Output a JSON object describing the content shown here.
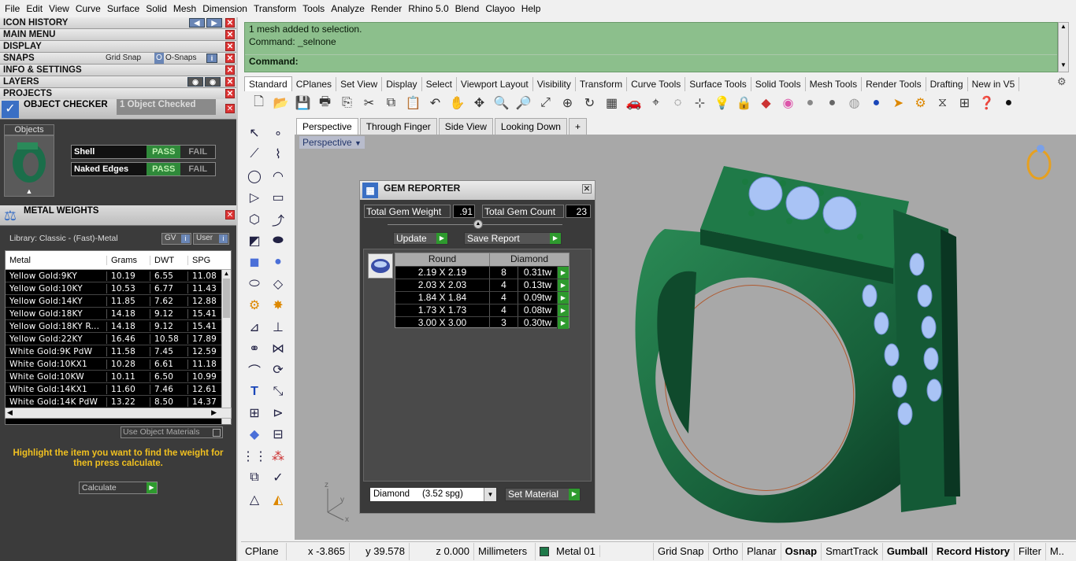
{
  "menu": [
    "File",
    "Edit",
    "View",
    "Curve",
    "Surface",
    "Solid",
    "Mesh",
    "Dimension",
    "Transform",
    "Tools",
    "Analyze",
    "Render",
    "Rhino 5.0",
    "Blend",
    "Clayoo",
    "Help"
  ],
  "left": {
    "sections": {
      "icon_history": "ICON HISTORY",
      "main_menu": "MAIN MENU",
      "display": "DISPLAY",
      "snaps": "SNAPS",
      "snaps_grid": "Grid Snap",
      "snaps_osnap": "O-Snaps",
      "info": "INFO & SETTINGS",
      "layers": "LAYERS",
      "projects": "PROJECTS"
    },
    "object_checker": {
      "title": "OBJECT CHECKER",
      "status": "1 Object Checked",
      "objects_label": "Objects",
      "rows": [
        {
          "label": "Shell",
          "pass": "PASS",
          "fail": "FAIL"
        },
        {
          "label": "Naked Edges",
          "pass": "PASS",
          "fail": "FAIL"
        }
      ]
    },
    "metal_weights": {
      "title": "METAL WEIGHTS",
      "library": "Library: Classic - (Fast)-Metal",
      "gv": "GV",
      "user": "User",
      "headers": [
        "Metal",
        "Grams",
        "DWT",
        "SPG"
      ],
      "rows": [
        [
          "Yellow Gold:9KY",
          "10.19",
          "6.55",
          "11.08"
        ],
        [
          "Yellow Gold:10KY",
          "10.53",
          "6.77",
          "11.43"
        ],
        [
          "Yellow Gold:14KY",
          "11.85",
          "7.62",
          "12.88"
        ],
        [
          "Yellow Gold:18KY",
          "14.18",
          "9.12",
          "15.41"
        ],
        [
          "Yellow Gold:18KY R...",
          "14.18",
          "9.12",
          "15.41"
        ],
        [
          "Yellow Gold:22KY",
          "16.46",
          "10.58",
          "17.89"
        ],
        [
          "White Gold:9K PdW",
          "11.58",
          "7.45",
          "12.59"
        ],
        [
          "White Gold:10KX1",
          "10.28",
          "6.61",
          "11.18"
        ],
        [
          "White Gold:10KW",
          "10.11",
          "6.50",
          "10.99"
        ],
        [
          "White Gold:14KX1",
          "11.60",
          "7.46",
          "12.61"
        ],
        [
          "White Gold:14K PdW",
          "13.22",
          "8.50",
          "14.37"
        ]
      ],
      "use_object_materials": "Use Object Materials",
      "hint": "Highlight the item you want to find the weight for then press calculate.",
      "calculate": "Calculate"
    }
  },
  "command": {
    "line1": "1 mesh added to selection.",
    "line2": "Command: _selnone",
    "prompt": "Command:"
  },
  "tabs": [
    "Standard",
    "CPlanes",
    "Set View",
    "Display",
    "Select",
    "Viewport Layout",
    "Visibility",
    "Transform",
    "Curve Tools",
    "Surface Tools",
    "Solid Tools",
    "Mesh Tools",
    "Render Tools",
    "Drafting",
    "New in V5"
  ],
  "viewport_tabs": [
    "Perspective",
    "Through Finger",
    "Side View",
    "Looking Down",
    "+"
  ],
  "viewport_title": "Perspective",
  "gem": {
    "title": "GEM REPORTER",
    "total_weight_label": "Total Gem Weight",
    "total_weight": ".91",
    "total_count_label": "Total Gem Count",
    "total_count": "23",
    "update": "Update",
    "save_report": "Save Report",
    "headers": [
      "Round",
      "Diamond"
    ],
    "rows": [
      [
        "2.19 X 2.19",
        "8",
        "0.31tw"
      ],
      [
        "2.03 X 2.03",
        "4",
        "0.13tw"
      ],
      [
        "1.84 X 1.84",
        "4",
        "0.09tw"
      ],
      [
        "1.73 X 1.73",
        "4",
        "0.08tw"
      ],
      [
        "3.00 X 3.00",
        "3",
        "0.30tw"
      ]
    ],
    "material": "Diamond     (3.52 spg)",
    "set_material": "Set Material"
  },
  "status": {
    "cplane": "CPlane",
    "x": "x -3.865",
    "y": "y 39.578",
    "z": "z 0.000",
    "units": "Millimeters",
    "layer": "Metal 01",
    "layer_color": "#1f7a4a",
    "toggles": [
      "Grid Snap",
      "Ortho",
      "Planar",
      "Osnap",
      "SmartTrack",
      "Gumball",
      "Record History",
      "Filter",
      "M.."
    ]
  },
  "colors": {
    "ring": "#1c6b40",
    "gem": "#a9c3f5",
    "panel": "#3b3b3b",
    "command": "#8cbf8c"
  }
}
